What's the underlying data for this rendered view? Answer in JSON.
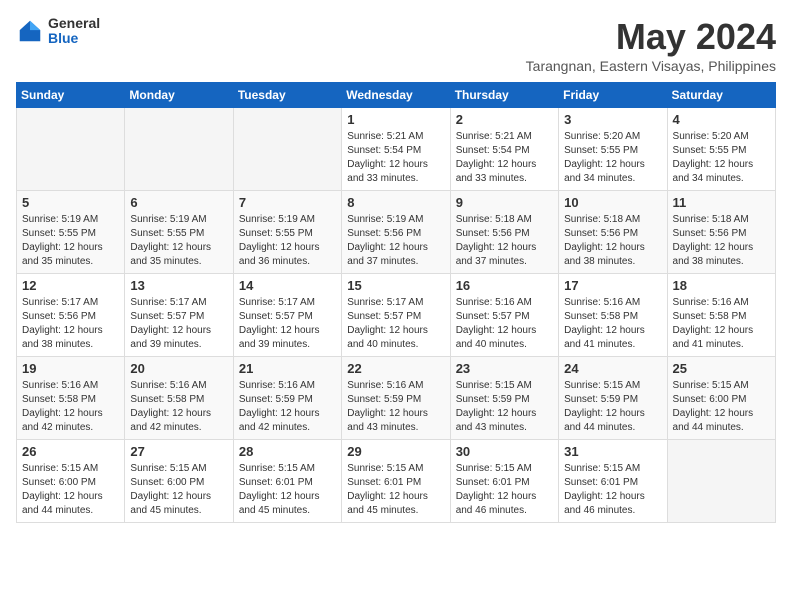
{
  "logo": {
    "general": "General",
    "blue": "Blue"
  },
  "title": "May 2024",
  "location": "Tarangnan, Eastern Visayas, Philippines",
  "days_of_week": [
    "Sunday",
    "Monday",
    "Tuesday",
    "Wednesday",
    "Thursday",
    "Friday",
    "Saturday"
  ],
  "weeks": [
    [
      {
        "day": "",
        "info": ""
      },
      {
        "day": "",
        "info": ""
      },
      {
        "day": "",
        "info": ""
      },
      {
        "day": "1",
        "info": "Sunrise: 5:21 AM\nSunset: 5:54 PM\nDaylight: 12 hours\nand 33 minutes."
      },
      {
        "day": "2",
        "info": "Sunrise: 5:21 AM\nSunset: 5:54 PM\nDaylight: 12 hours\nand 33 minutes."
      },
      {
        "day": "3",
        "info": "Sunrise: 5:20 AM\nSunset: 5:55 PM\nDaylight: 12 hours\nand 34 minutes."
      },
      {
        "day": "4",
        "info": "Sunrise: 5:20 AM\nSunset: 5:55 PM\nDaylight: 12 hours\nand 34 minutes."
      }
    ],
    [
      {
        "day": "5",
        "info": "Sunrise: 5:19 AM\nSunset: 5:55 PM\nDaylight: 12 hours\nand 35 minutes."
      },
      {
        "day": "6",
        "info": "Sunrise: 5:19 AM\nSunset: 5:55 PM\nDaylight: 12 hours\nand 35 minutes."
      },
      {
        "day": "7",
        "info": "Sunrise: 5:19 AM\nSunset: 5:55 PM\nDaylight: 12 hours\nand 36 minutes."
      },
      {
        "day": "8",
        "info": "Sunrise: 5:19 AM\nSunset: 5:56 PM\nDaylight: 12 hours\nand 37 minutes."
      },
      {
        "day": "9",
        "info": "Sunrise: 5:18 AM\nSunset: 5:56 PM\nDaylight: 12 hours\nand 37 minutes."
      },
      {
        "day": "10",
        "info": "Sunrise: 5:18 AM\nSunset: 5:56 PM\nDaylight: 12 hours\nand 38 minutes."
      },
      {
        "day": "11",
        "info": "Sunrise: 5:18 AM\nSunset: 5:56 PM\nDaylight: 12 hours\nand 38 minutes."
      }
    ],
    [
      {
        "day": "12",
        "info": "Sunrise: 5:17 AM\nSunset: 5:56 PM\nDaylight: 12 hours\nand 38 minutes."
      },
      {
        "day": "13",
        "info": "Sunrise: 5:17 AM\nSunset: 5:57 PM\nDaylight: 12 hours\nand 39 minutes."
      },
      {
        "day": "14",
        "info": "Sunrise: 5:17 AM\nSunset: 5:57 PM\nDaylight: 12 hours\nand 39 minutes."
      },
      {
        "day": "15",
        "info": "Sunrise: 5:17 AM\nSunset: 5:57 PM\nDaylight: 12 hours\nand 40 minutes."
      },
      {
        "day": "16",
        "info": "Sunrise: 5:16 AM\nSunset: 5:57 PM\nDaylight: 12 hours\nand 40 minutes."
      },
      {
        "day": "17",
        "info": "Sunrise: 5:16 AM\nSunset: 5:58 PM\nDaylight: 12 hours\nand 41 minutes."
      },
      {
        "day": "18",
        "info": "Sunrise: 5:16 AM\nSunset: 5:58 PM\nDaylight: 12 hours\nand 41 minutes."
      }
    ],
    [
      {
        "day": "19",
        "info": "Sunrise: 5:16 AM\nSunset: 5:58 PM\nDaylight: 12 hours\nand 42 minutes."
      },
      {
        "day": "20",
        "info": "Sunrise: 5:16 AM\nSunset: 5:58 PM\nDaylight: 12 hours\nand 42 minutes."
      },
      {
        "day": "21",
        "info": "Sunrise: 5:16 AM\nSunset: 5:59 PM\nDaylight: 12 hours\nand 42 minutes."
      },
      {
        "day": "22",
        "info": "Sunrise: 5:16 AM\nSunset: 5:59 PM\nDaylight: 12 hours\nand 43 minutes."
      },
      {
        "day": "23",
        "info": "Sunrise: 5:15 AM\nSunset: 5:59 PM\nDaylight: 12 hours\nand 43 minutes."
      },
      {
        "day": "24",
        "info": "Sunrise: 5:15 AM\nSunset: 5:59 PM\nDaylight: 12 hours\nand 44 minutes."
      },
      {
        "day": "25",
        "info": "Sunrise: 5:15 AM\nSunset: 6:00 PM\nDaylight: 12 hours\nand 44 minutes."
      }
    ],
    [
      {
        "day": "26",
        "info": "Sunrise: 5:15 AM\nSunset: 6:00 PM\nDaylight: 12 hours\nand 44 minutes."
      },
      {
        "day": "27",
        "info": "Sunrise: 5:15 AM\nSunset: 6:00 PM\nDaylight: 12 hours\nand 45 minutes."
      },
      {
        "day": "28",
        "info": "Sunrise: 5:15 AM\nSunset: 6:01 PM\nDaylight: 12 hours\nand 45 minutes."
      },
      {
        "day": "29",
        "info": "Sunrise: 5:15 AM\nSunset: 6:01 PM\nDaylight: 12 hours\nand 45 minutes."
      },
      {
        "day": "30",
        "info": "Sunrise: 5:15 AM\nSunset: 6:01 PM\nDaylight: 12 hours\nand 46 minutes."
      },
      {
        "day": "31",
        "info": "Sunrise: 5:15 AM\nSunset: 6:01 PM\nDaylight: 12 hours\nand 46 minutes."
      },
      {
        "day": "",
        "info": ""
      }
    ]
  ]
}
